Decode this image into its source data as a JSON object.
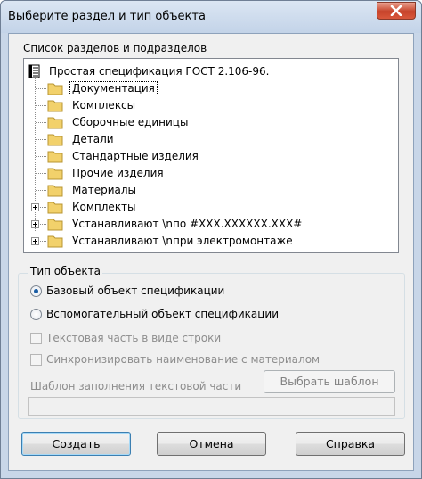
{
  "window": {
    "title": "Выберите раздел и тип объекта"
  },
  "sections": {
    "label": "Список разделов и подразделов",
    "root": "Простая спецификация ГОСТ 2.106-96.",
    "items": [
      {
        "label": "Документация",
        "selected": true,
        "expandable": false
      },
      {
        "label": "Комплексы",
        "selected": false,
        "expandable": false
      },
      {
        "label": "Сборочные единицы",
        "selected": false,
        "expandable": false
      },
      {
        "label": "Детали",
        "selected": false,
        "expandable": false
      },
      {
        "label": "Стандартные изделия",
        "selected": false,
        "expandable": false
      },
      {
        "label": "Прочие изделия",
        "selected": false,
        "expandable": false
      },
      {
        "label": "Материалы",
        "selected": false,
        "expandable": false
      },
      {
        "label": "Комплекты",
        "selected": false,
        "expandable": true
      },
      {
        "label": "Устанавливают \\nпо #XXX.XXXXXX.XXX#",
        "selected": false,
        "expandable": true
      },
      {
        "label": "Устанавливают \\nпри электромонтаже",
        "selected": false,
        "expandable": true
      }
    ]
  },
  "object_type": {
    "title": "Тип объекта",
    "base_label": "Базовый объект спецификации",
    "base_checked": true,
    "aux_label": "Вспомогательный объект спецификации",
    "aux_checked": false,
    "text_part_label": "Текстовая часть в виде строки",
    "sync_label": "Синхронизировать наименование с материалом",
    "template_label": "Шаблон заполнения текстовой части",
    "choose_template_label": "Выбрать шаблон",
    "template_value": ""
  },
  "buttons": {
    "create": "Создать",
    "cancel": "Отмена",
    "help": "Справка"
  },
  "colors": {
    "folder": "#f2d16b",
    "radio_dot": "#1a5da4",
    "close_button": "#c7432a",
    "title_bar": "#c8d6e8"
  }
}
